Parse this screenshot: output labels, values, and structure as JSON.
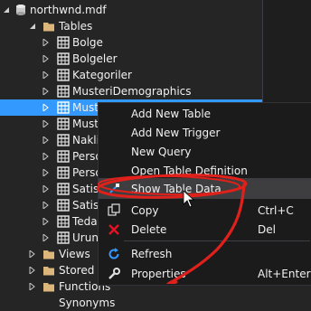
{
  "tree": {
    "root": "northwnd.mdf",
    "tables_folder": "Tables",
    "tables": [
      "Bolge",
      "Bolgeler",
      "Kategoriler",
      "MusteriDemographics",
      "Musteri",
      "Muste",
      "Nakliy",
      "Persor",
      "Persor",
      "Satis D",
      "Satisla",
      "Tedari",
      "Urunle"
    ],
    "folders": [
      "Views",
      "Stored Pro",
      "Functions",
      "Synonyms"
    ]
  },
  "context_menu": {
    "items": [
      {
        "label": "Add New Table",
        "shortcut": "",
        "icon": ""
      },
      {
        "label": "Add New Trigger",
        "shortcut": "",
        "icon": ""
      },
      {
        "label": "New Query",
        "shortcut": "",
        "icon": ""
      },
      {
        "label": "Open Table Definition",
        "shortcut": "",
        "icon": ""
      },
      {
        "label": "Show Table Data",
        "shortcut": "",
        "icon": "table-data-icon"
      },
      {
        "label": "Copy",
        "shortcut": "Ctrl+C",
        "icon": "copy-icon"
      },
      {
        "label": "Delete",
        "shortcut": "Del",
        "icon": "delete-icon"
      },
      {
        "label": "Refresh",
        "shortcut": "",
        "icon": "refresh-icon"
      },
      {
        "label": "Properties",
        "shortcut": "Alt+Enter",
        "icon": "wrench-icon"
      }
    ]
  },
  "colors": {
    "selection": "#3399ff",
    "annotation": "#e0201b",
    "delete": "#e81123",
    "refresh": "#3399ff",
    "folder": "#dcb67a"
  }
}
